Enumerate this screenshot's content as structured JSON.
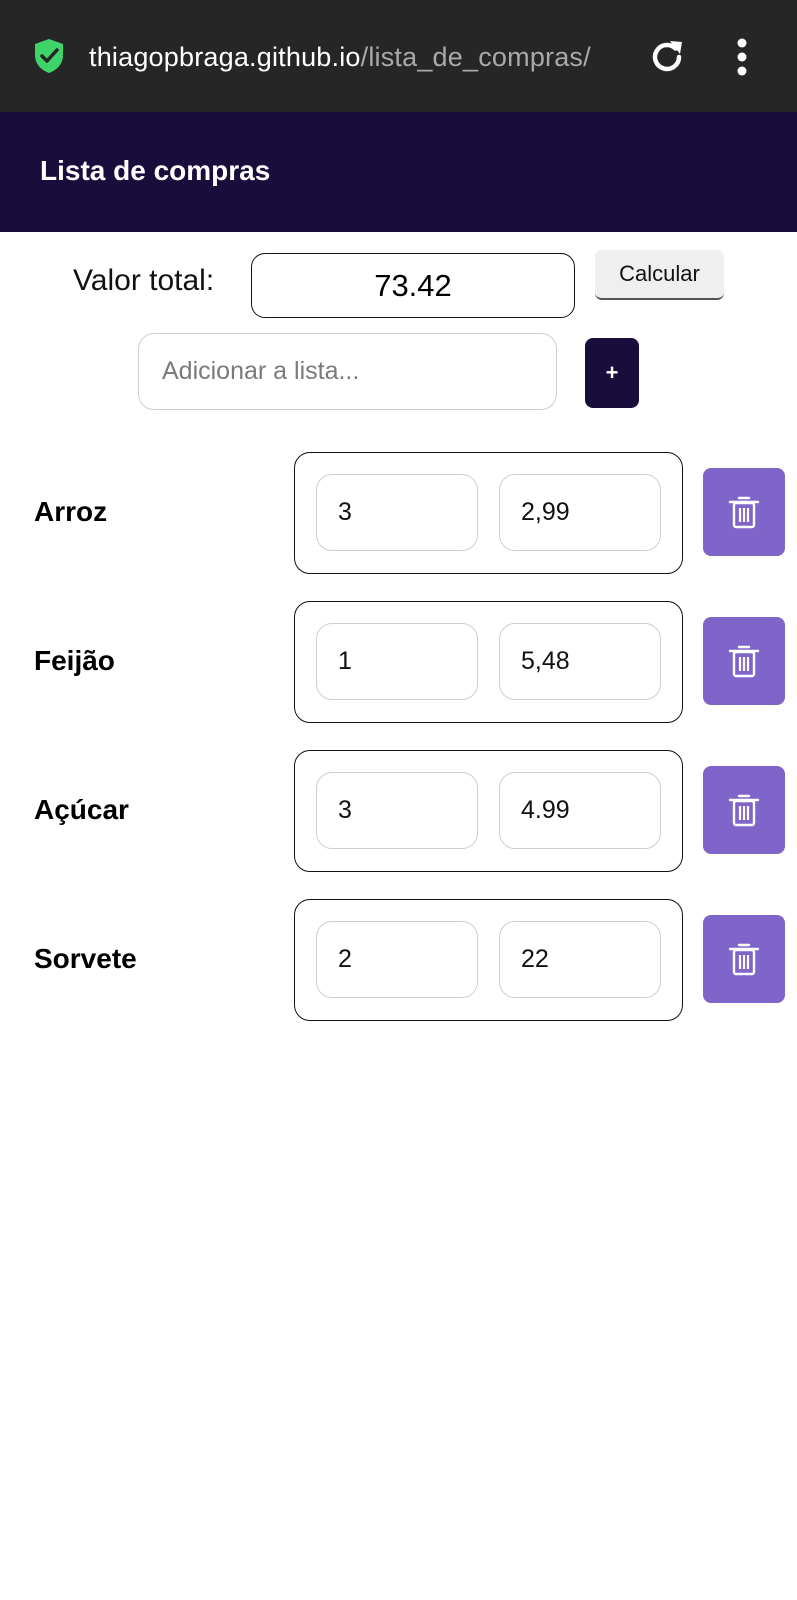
{
  "browser": {
    "url_host": "thiagopbraga.github.io",
    "url_path": "/lista_de_compras/",
    "icons": {
      "secure": "shield-check-icon",
      "reload": "reload-icon",
      "menu": "more-vert-icon"
    }
  },
  "header": {
    "title": "Lista de compras"
  },
  "total": {
    "label": "Valor total:",
    "value": "73.42",
    "calculate_label": "Calcular"
  },
  "add": {
    "placeholder": "Adicionar a lista...",
    "button_label": "+"
  },
  "items": [
    {
      "name": "Arroz",
      "quantity": "3",
      "price": "2,99"
    },
    {
      "name": "Feijão",
      "quantity": "1",
      "price": "5,48"
    },
    {
      "name": "Açúcar",
      "quantity": "3",
      "price": "4.99"
    },
    {
      "name": "Sorvete",
      "quantity": "2",
      "price": "22"
    }
  ],
  "colors": {
    "browser_bar": "#262626",
    "header_bg": "#180d3b",
    "delete_button": "#7f65c9",
    "secure_icon": "#3fd46a"
  }
}
